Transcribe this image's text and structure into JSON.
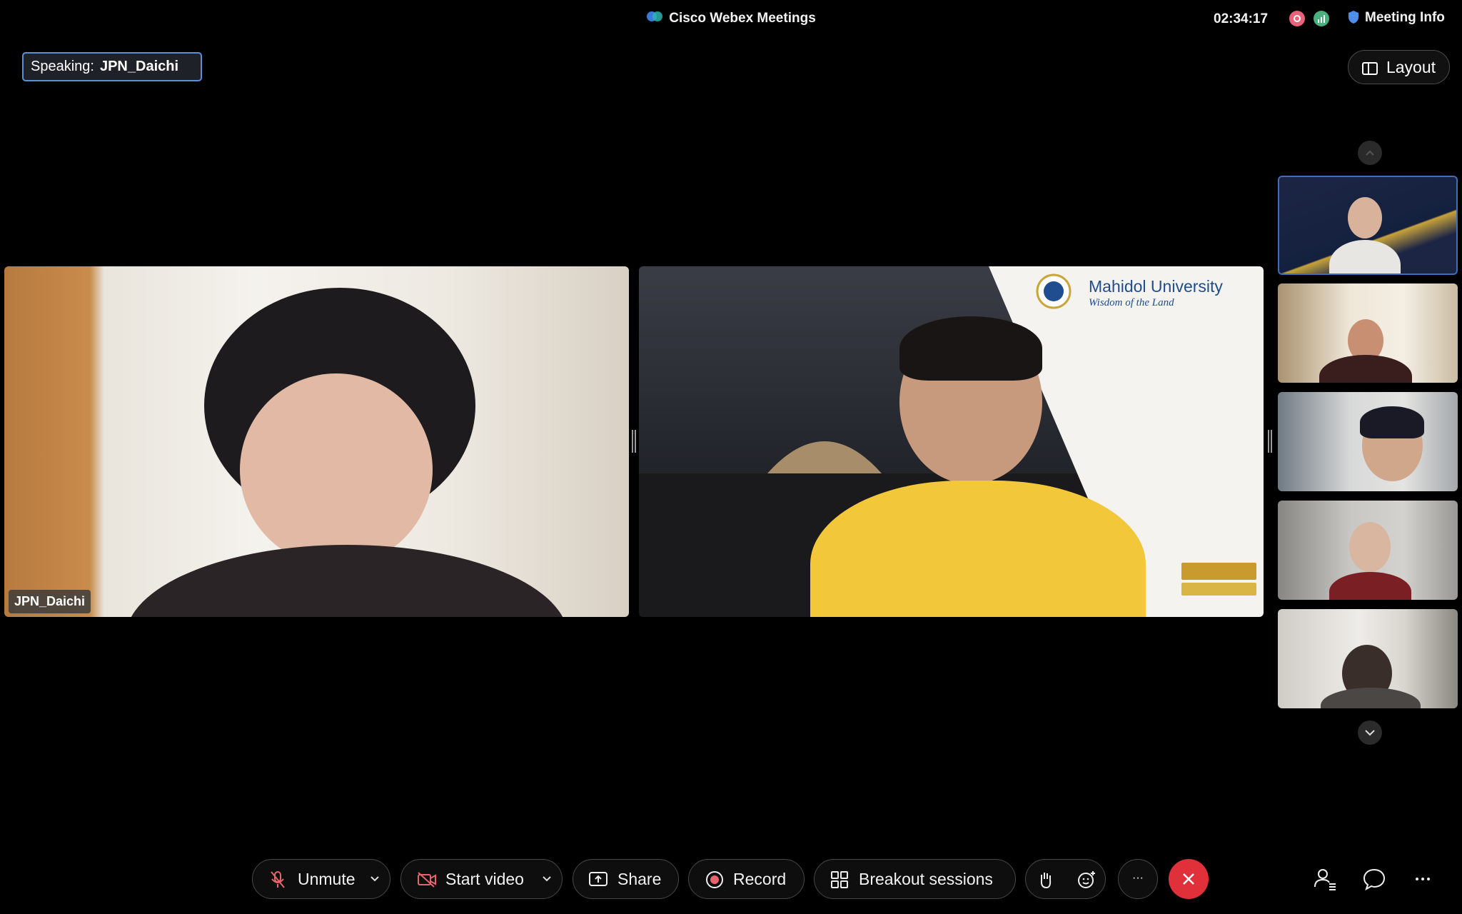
{
  "window": {
    "title": "Cisco Webex Meetings",
    "clock": "02:34:17",
    "meeting_info_label": "Meeting Info"
  },
  "speaking": {
    "prefix": "Speaking:",
    "name": "JPN_Daichi"
  },
  "layout_button": {
    "label": "Layout"
  },
  "videos": [
    {
      "name": "JPN_Daichi"
    },
    {
      "name": "",
      "background": {
        "org_name": "Mahidol University",
        "tagline": "Wisdom of the Land"
      }
    }
  ],
  "controls": {
    "unmute": "Unmute",
    "start_video": "Start video",
    "share": "Share",
    "record": "Record",
    "breakout": "Breakout sessions",
    "more": "···"
  },
  "colors": {
    "end_call": "#e0303a",
    "speaking_border": "#5b8fd6",
    "recording": "#e8627a",
    "network": "#4caf7d"
  },
  "icons": [
    "webex-logo-icon",
    "record-indicator-icon",
    "network-icon",
    "shield-icon",
    "layout-icon",
    "mic-muted-icon",
    "video-off-icon",
    "share-icon",
    "record-icon",
    "breakout-icon",
    "raise-hand-icon",
    "reactions-icon",
    "end-call-icon",
    "participants-icon",
    "chat-icon",
    "more-icon"
  ]
}
